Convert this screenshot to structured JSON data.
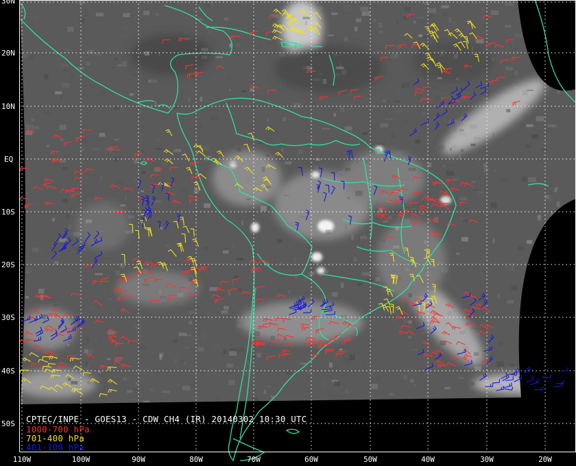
{
  "caption": {
    "title": "CPTEC/INPE - GOES13 - CDW CH4 (IR) 20140302 10:30 UTC"
  },
  "legend": [
    {
      "label": "1000-700 hPa",
      "color": "#ff3030"
    },
    {
      "label": "701-400 hPa",
      "color": "#f0e020"
    },
    {
      "label": "401-100 hPa",
      "color": "#1818e0"
    }
  ],
  "lat_labels": [
    "30N",
    "20N",
    "10N",
    "EQ",
    "10S",
    "20S",
    "30S",
    "40S",
    "50S"
  ],
  "lon_labels": [
    "110W",
    "100W",
    "90W",
    "80W",
    "70W",
    "60W",
    "50W",
    "40W",
    "30W",
    "20W"
  ],
  "colors": {
    "background": "#000000",
    "coastline": "#30e0a0",
    "grid": "#ffffff"
  },
  "wind_regions": [
    {
      "level": "low",
      "count": 300
    },
    {
      "level": "mid",
      "count": 160
    },
    {
      "level": "high",
      "count": 150
    }
  ]
}
